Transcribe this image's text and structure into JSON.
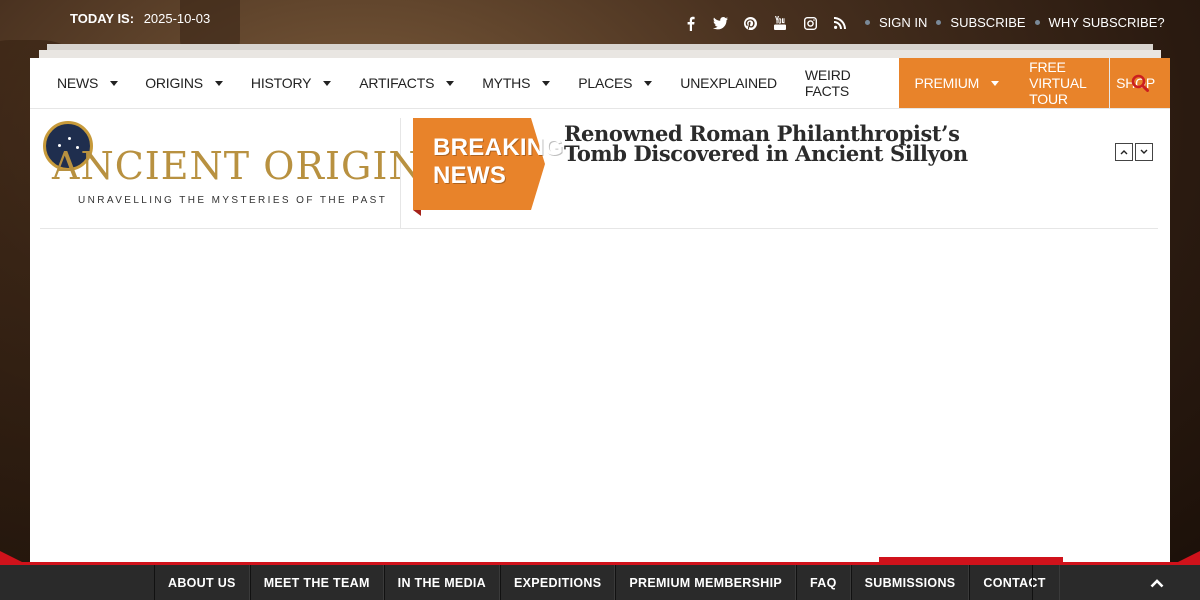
{
  "topbar": {
    "today_label": "TODAY IS:",
    "today_date": "2025-10-03",
    "social_icons": [
      "facebook-icon",
      "twitter-icon",
      "pinterest-icon",
      "youtube-icon",
      "instagram-icon",
      "rss-icon"
    ],
    "links": [
      "SIGN IN",
      "SUBSCRIBE",
      "WHY SUBSCRIBE?"
    ]
  },
  "nav": {
    "items": [
      {
        "label": "NEWS",
        "dropdown": true
      },
      {
        "label": "ORIGINS",
        "dropdown": true
      },
      {
        "label": "HISTORY",
        "dropdown": true
      },
      {
        "label": "ARTIFACTS",
        "dropdown": true
      },
      {
        "label": "MYTHS",
        "dropdown": true
      },
      {
        "label": "PLACES",
        "dropdown": true
      },
      {
        "label": "UNEXPLAINED",
        "dropdown": false
      },
      {
        "label": "WEIRD FACTS",
        "dropdown": false
      }
    ],
    "highlight_items": [
      {
        "label": "PREMIUM",
        "dropdown": true
      },
      {
        "label": "FREE VIRTUAL TOUR",
        "dropdown": false
      },
      {
        "label": "SHOP",
        "dropdown": false
      }
    ],
    "search_icon": "search-icon"
  },
  "header": {
    "logo_text": "ANCIENT ORIGINS",
    "logo_tagline": "UNRAVELLING THE MYSTERIES OF THE PAST",
    "breaking_line1": "BREAKING",
    "breaking_line2": "NEWS",
    "headline": "Renowned Roman Philanthropist’s Tomb Discovered in Ancient Sillyon"
  },
  "footer": {
    "links": [
      "ABOUT US",
      "MEET THE TEAM",
      "IN THE MEDIA",
      "EXPEDITIONS",
      "PREMIUM MEMBERSHIP",
      "FAQ",
      "SUBMISSIONS",
      "CONTACT"
    ]
  },
  "colors": {
    "accent_orange": "#e8832a",
    "footer_red": "#d0121b",
    "footer_bg": "#2a2a2a",
    "search_red": "#cc1f1f"
  }
}
